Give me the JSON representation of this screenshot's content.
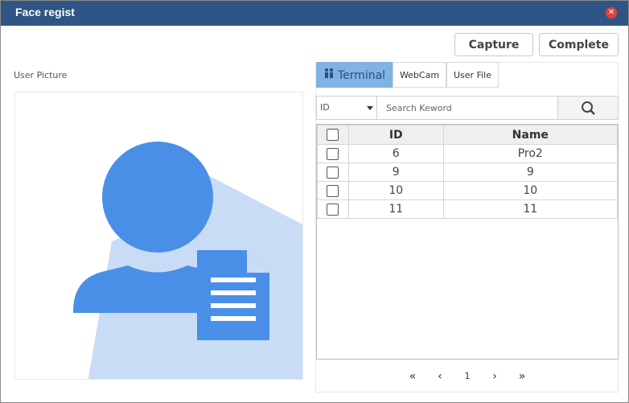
{
  "window": {
    "title": "Face regist"
  },
  "toolbar": {
    "capture_label": "Capture",
    "complete_label": "Complete"
  },
  "left": {
    "label": "User Picture"
  },
  "tabs": [
    {
      "label": "Terminal",
      "active": true
    },
    {
      "label": "WebCam"
    },
    {
      "label": "User File"
    }
  ],
  "search": {
    "select_value": "ID",
    "placeholder": "Search Keword"
  },
  "table": {
    "headers": [
      "ID",
      "Name"
    ],
    "rows": [
      {
        "id": "6",
        "name": "Pro2"
      },
      {
        "id": "9",
        "name": "9"
      },
      {
        "id": "10",
        "name": "10"
      },
      {
        "id": "11",
        "name": "11"
      }
    ]
  },
  "pager": {
    "first": "«",
    "prev": "‹",
    "page": "1",
    "next": "›",
    "last": "»"
  },
  "colors": {
    "titlebar": "#2e5583",
    "accent": "#4a8fe7",
    "tab_active": "#7fb3e4",
    "close": "#e4403a"
  }
}
